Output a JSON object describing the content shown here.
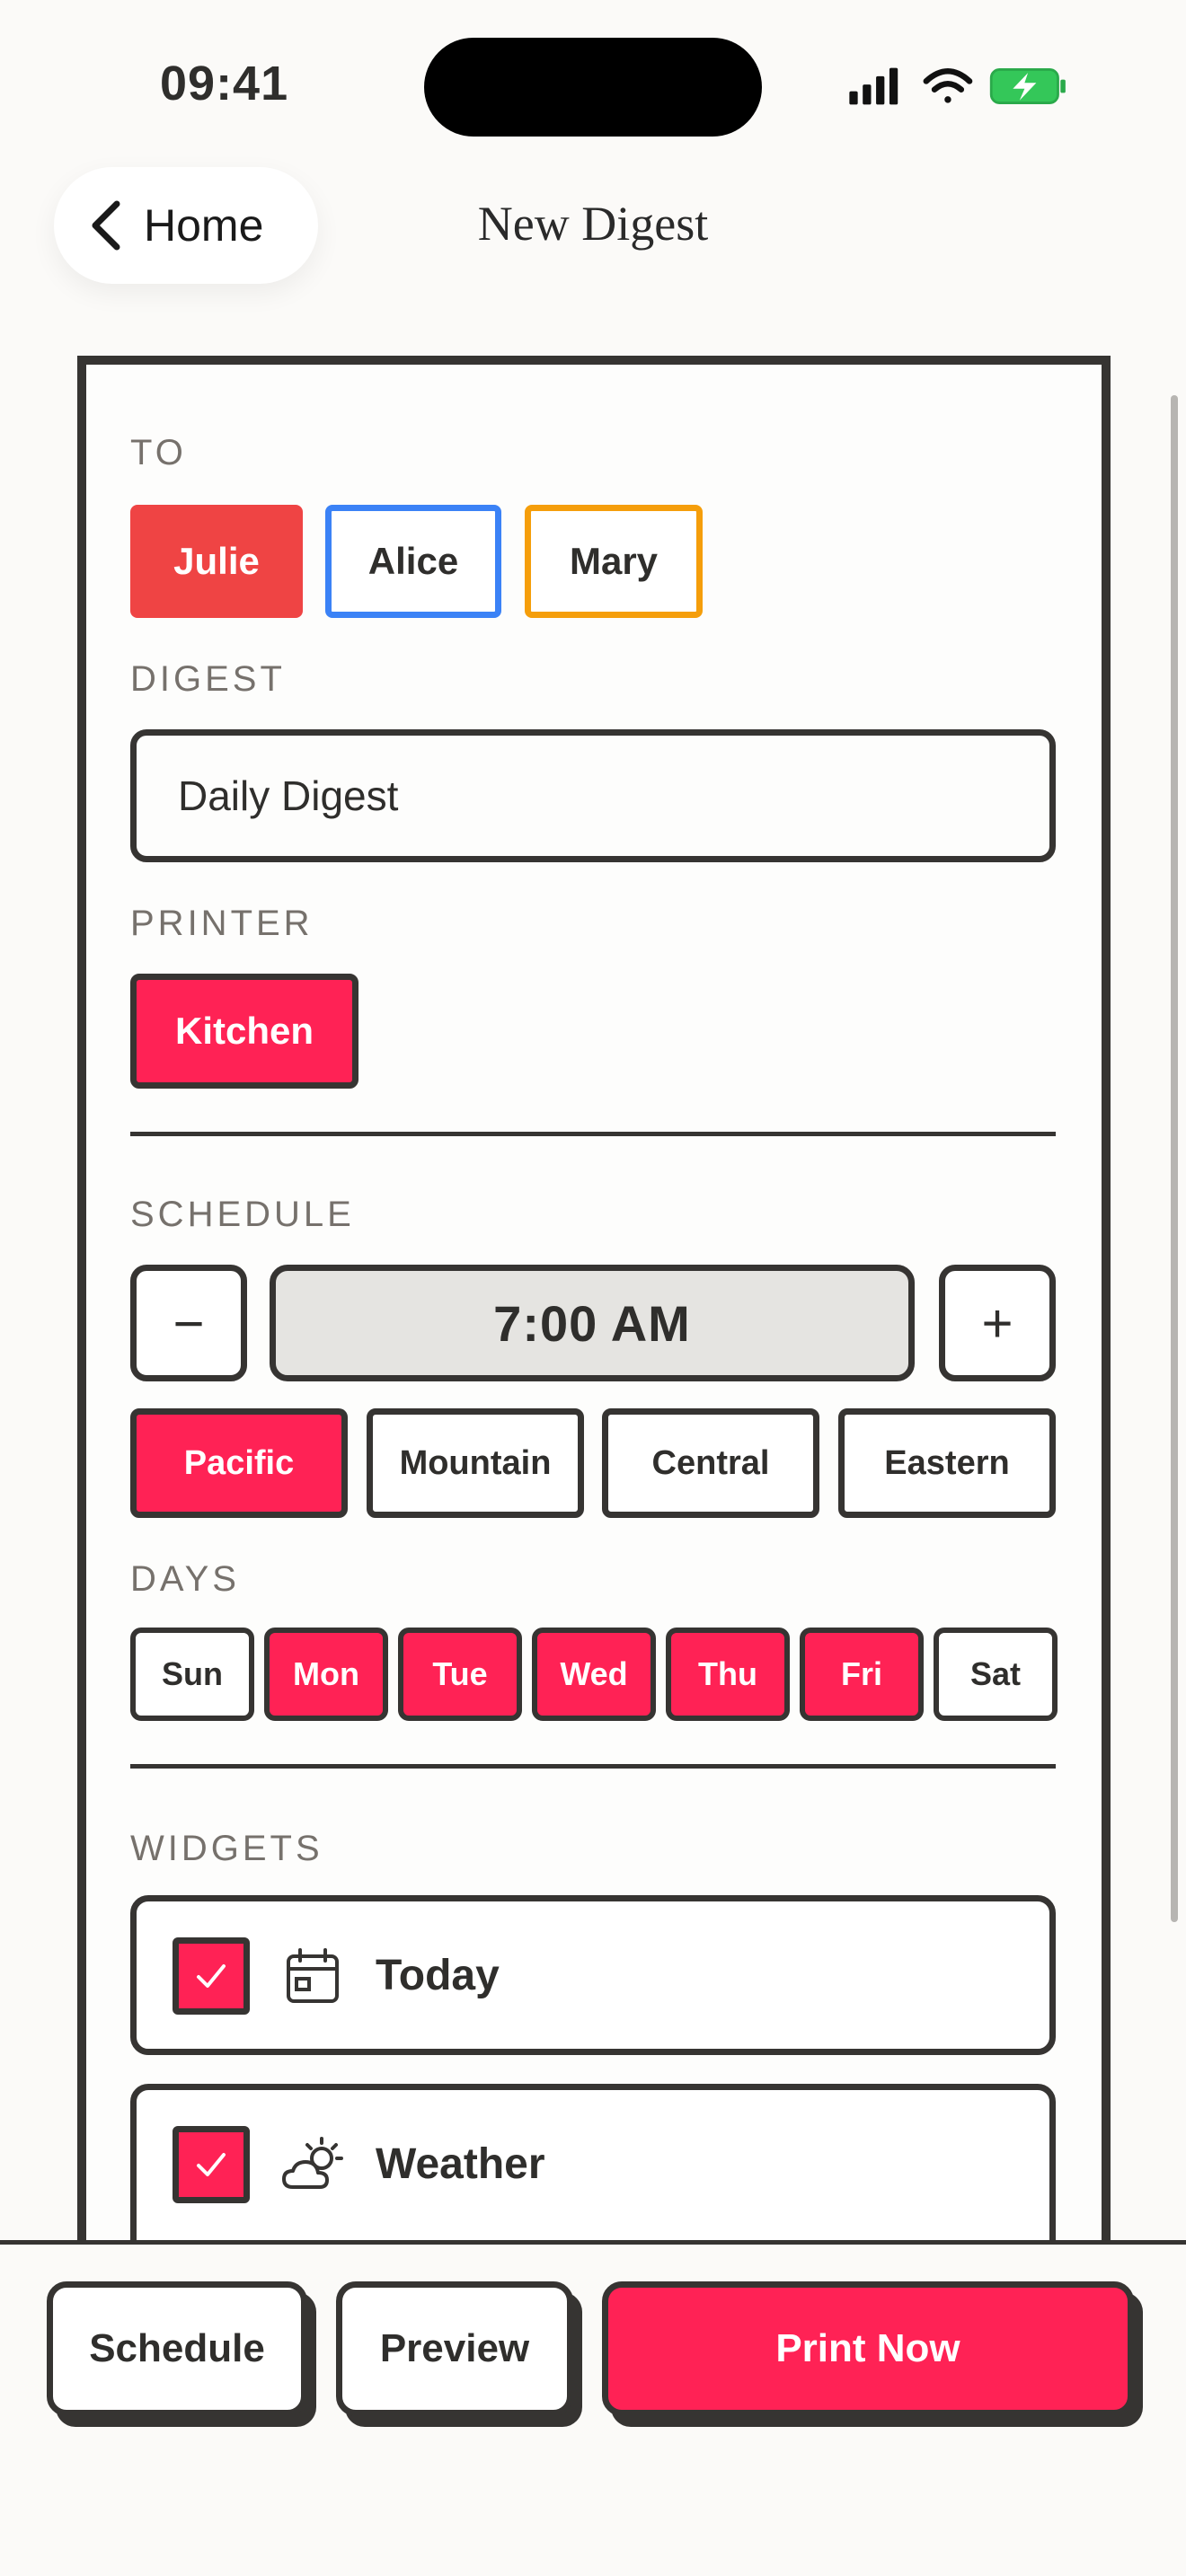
{
  "status_bar": {
    "time": "09:41"
  },
  "nav": {
    "back_label": "Home",
    "title": "New Digest"
  },
  "to": {
    "label": "TO",
    "recipients": [
      {
        "name": "Julie",
        "selected": true,
        "color": "#ef4444"
      },
      {
        "name": "Alice",
        "selected": false,
        "color": "#3b82f6"
      },
      {
        "name": "Mary",
        "selected": false,
        "color": "#f59e0b"
      }
    ]
  },
  "digest": {
    "label": "DIGEST",
    "value": "Daily Digest"
  },
  "printer": {
    "label": "PRINTER",
    "options": [
      {
        "name": "Kitchen",
        "selected": true
      }
    ]
  },
  "schedule": {
    "label": "SCHEDULE",
    "time": "7:00 AM",
    "decrement_symbol": "−",
    "increment_symbol": "+",
    "timezones": [
      {
        "name": "Pacific",
        "selected": true
      },
      {
        "name": "Mountain",
        "selected": false
      },
      {
        "name": "Central",
        "selected": false
      },
      {
        "name": "Eastern",
        "selected": false
      }
    ]
  },
  "days": {
    "label": "DAYS",
    "items": [
      {
        "name": "Sun",
        "selected": false
      },
      {
        "name": "Mon",
        "selected": true
      },
      {
        "name": "Tue",
        "selected": true
      },
      {
        "name": "Wed",
        "selected": true
      },
      {
        "name": "Thu",
        "selected": true
      },
      {
        "name": "Fri",
        "selected": true
      },
      {
        "name": "Sat",
        "selected": false
      }
    ]
  },
  "widgets": {
    "label": "WIDGETS",
    "items": [
      {
        "name": "Today",
        "checked": true,
        "icon": "calendar-icon"
      },
      {
        "name": "Weather",
        "checked": true,
        "icon": "partly-sunny-icon"
      }
    ]
  },
  "actions": {
    "schedule": "Schedule",
    "preview": "Preview",
    "print_now": "Print Now"
  },
  "colors": {
    "accent": "#ff2255",
    "ink": "#363432",
    "muted": "#76716c",
    "background": "#fbfaf8"
  }
}
